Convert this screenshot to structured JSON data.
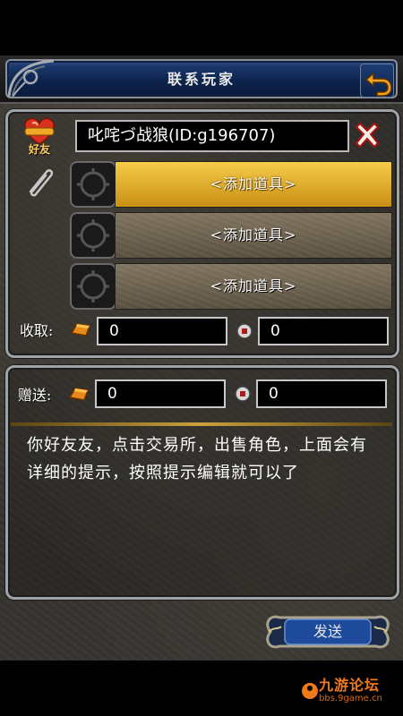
{
  "header": {
    "title": "联系玩家",
    "back_icon": "return-arrow-icon",
    "accent": "#f7a21c"
  },
  "recipient": {
    "badge_icon": "heart-friend-icon",
    "badge_label": "好友",
    "name": "叱咤づ战狼(ID:g196707)",
    "clear_icon": "close-x-icon"
  },
  "attachments": {
    "clip_icon": "paperclip-icon",
    "slots": [
      {
        "label": "<添加道具>",
        "state": "selected"
      },
      {
        "label": "<添加道具>",
        "state": "normal"
      },
      {
        "label": "<添加道具>",
        "state": "normal"
      }
    ]
  },
  "receive": {
    "label": "收取:",
    "gold_icon": "gold-ingot-icon",
    "gold_value": "0",
    "coin_icon": "coin-icon",
    "coin_value": "0"
  },
  "gift": {
    "label": "赠送:",
    "gold_icon": "gold-ingot-icon",
    "gold_value": "0",
    "coin_icon": "coin-icon",
    "coin_value": "0"
  },
  "message": {
    "text": "你好友友，点击交易所，出售角色，上面会有详细的提示，按照提示编辑就可以了"
  },
  "actions": {
    "send_label": "发送"
  },
  "watermark": {
    "brand": "九游论坛",
    "url": "bbs.9game.cn"
  }
}
